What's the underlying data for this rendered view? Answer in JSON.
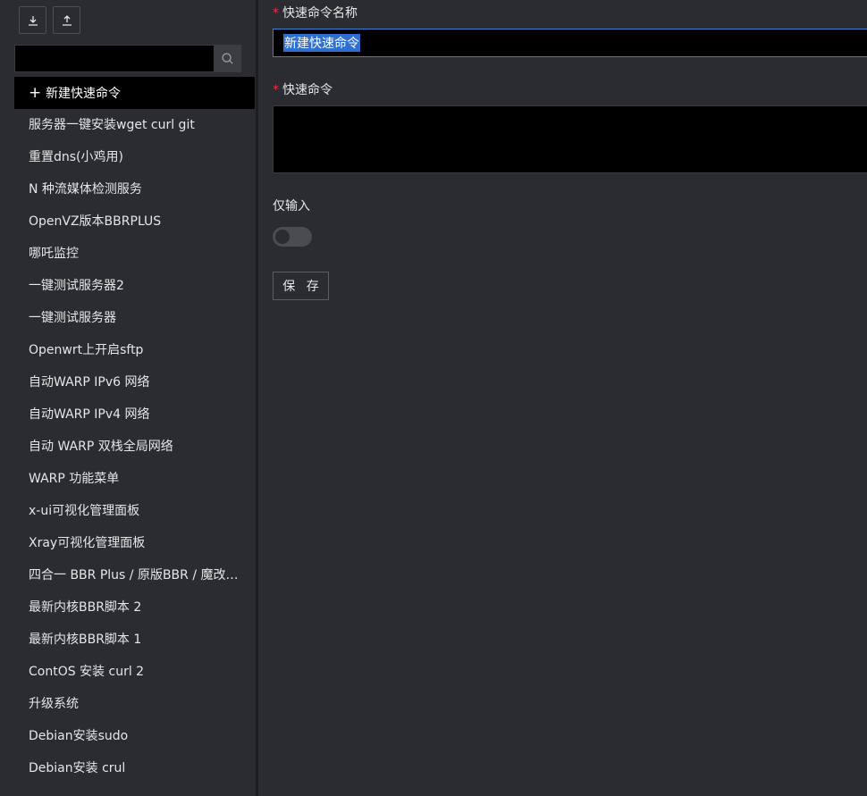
{
  "toolbar": {
    "import_icon": "download-icon",
    "export_icon": "upload-icon"
  },
  "search": {
    "value": "",
    "placeholder": "",
    "icon": "search-icon"
  },
  "sidebar": {
    "items": [
      {
        "label": "新建快速命令",
        "active": true
      },
      {
        "label": "服务器一键安装wget curl git"
      },
      {
        "label": "重置dns(小鸡用)"
      },
      {
        "label": "N 种流媒体检测服务"
      },
      {
        "label": "OpenVZ版本BBRPLUS"
      },
      {
        "label": "哪吒监控"
      },
      {
        "label": "一键测试服务器2"
      },
      {
        "label": "一键测试服务器"
      },
      {
        "label": "Openwrt上开启sftp"
      },
      {
        "label": "自动WARP IPv6 网络"
      },
      {
        "label": "自动WARP IPv4 网络"
      },
      {
        "label": "自动 WARP 双栈全局网络"
      },
      {
        "label": "WARP 功能菜单"
      },
      {
        "label": "x-ui可视化管理面板"
      },
      {
        "label": "Xray可视化管理面板"
      },
      {
        "label": "四合一 BBR Plus / 原版BBR / 魔改BBR / 锐速"
      },
      {
        "label": "最新内核BBR脚本 2"
      },
      {
        "label": "最新内核BBR脚本 1"
      },
      {
        "label": "ContOS 安装 curl 2"
      },
      {
        "label": "升级系统"
      },
      {
        "label": "Debian安装sudo"
      },
      {
        "label": "Debian安装 crul"
      }
    ]
  },
  "form": {
    "name_label": "快速命令名称",
    "name_value": "新建快速命令",
    "command_label": "快速命令",
    "command_value": "",
    "input_only_label": "仅输入",
    "input_only_on": false,
    "save_label": "保 存"
  },
  "colors": {
    "accent": "#3a82d4",
    "required": "#e0344c",
    "background": "#2a2c31"
  }
}
